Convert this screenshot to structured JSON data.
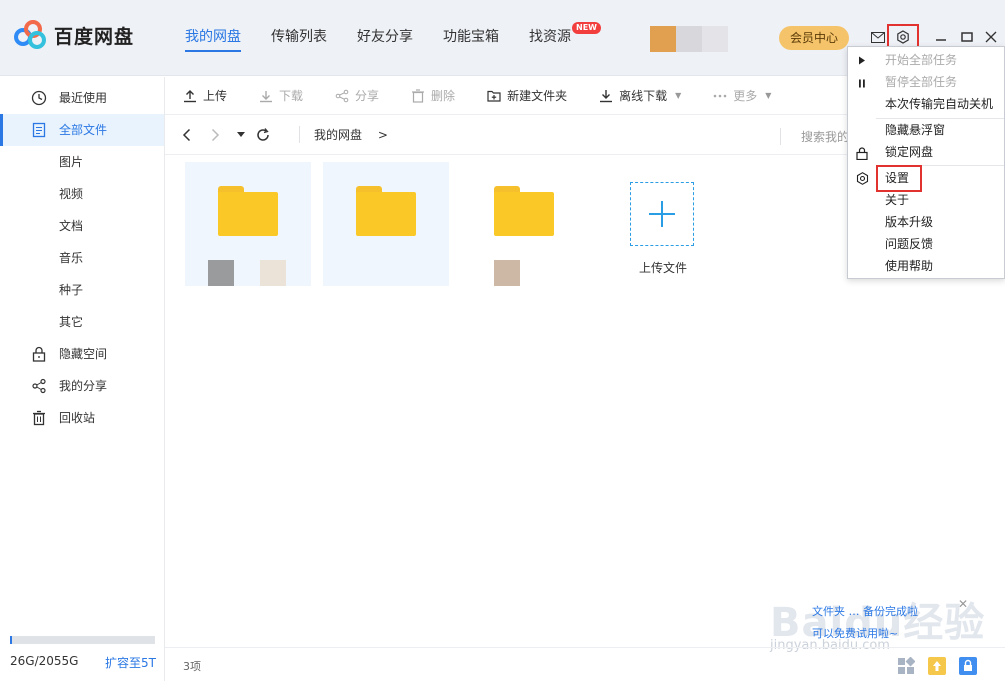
{
  "app": {
    "title": "百度网盘"
  },
  "nav": {
    "items": [
      {
        "label": "我的网盘"
      },
      {
        "label": "传输列表"
      },
      {
        "label": "好友分享"
      },
      {
        "label": "功能宝箱"
      },
      {
        "label": "找资源",
        "badge": "NEW"
      }
    ]
  },
  "header": {
    "vip_label": "会员中心"
  },
  "sidebar": {
    "items": [
      {
        "label": "最近使用"
      },
      {
        "label": "全部文件"
      },
      {
        "label": "图片"
      },
      {
        "label": "视频"
      },
      {
        "label": "文档"
      },
      {
        "label": "音乐"
      },
      {
        "label": "种子"
      },
      {
        "label": "其它"
      },
      {
        "label": "隐藏空间"
      },
      {
        "label": "我的分享"
      },
      {
        "label": "回收站"
      }
    ],
    "storage_text": "26G/2055G",
    "storage_link": "扩容至5T",
    "storage_fraction": 0.013
  },
  "toolbar": {
    "upload": "上传",
    "download": "下载",
    "share": "分享",
    "delete": "删除",
    "new_folder": "新建文件夹",
    "offline": "离线下载",
    "more": "更多"
  },
  "pathbar": {
    "path": "我的网盘",
    "sep": ">",
    "search_placeholder": "搜索我的"
  },
  "files": {
    "upload_label": "上传文件",
    "count": "3项"
  },
  "promo": {
    "line1": "文件夹 … 备份完成啦",
    "line2": "可以免费试用啦~"
  },
  "watermark": {
    "text": "Baidu经验",
    "url": "jingyan.baidu.com"
  },
  "menu": {
    "items": [
      {
        "label": "开始全部任务",
        "disabled": true
      },
      {
        "label": "暂停全部任务",
        "disabled": true
      },
      {
        "label": "本次传输完自动关机"
      },
      {
        "label": "隐藏悬浮窗"
      },
      {
        "label": "锁定网盘"
      },
      {
        "label": "设置"
      },
      {
        "label": "关于"
      },
      {
        "label": "版本升级"
      },
      {
        "label": "问题反馈"
      },
      {
        "label": "使用帮助"
      }
    ]
  },
  "colors": {
    "accent": "#2b78e4",
    "folder": "#fac928",
    "highlight": "#e2322f",
    "vip": "#f5c46a"
  }
}
